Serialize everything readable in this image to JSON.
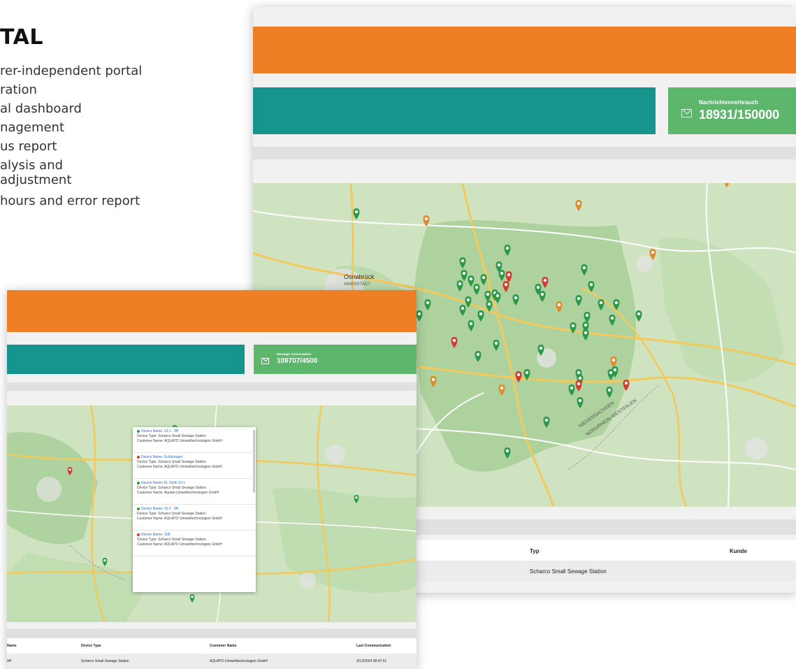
{
  "marketing": {
    "title": "TAL",
    "features": [
      "rer-independent portal",
      "ration",
      "al dashboard",
      "nagement",
      "us report",
      "alysis and",
      "adjustment",
      "hours and error report"
    ]
  },
  "back_screen": {
    "stat_label": "Nachrichtenverbrauch",
    "stat_value": "18931/150000",
    "map_labels": [
      "Osnabrück",
      "INNENSTADT",
      "NIEDERSACHSEN",
      "NORDRHEIN-WESTFALEN"
    ],
    "table_headers": [
      "Typ",
      "Kunde"
    ],
    "table_row": [
      "Scharco Small Sewage Station"
    ]
  },
  "front_screen": {
    "stat_label": "Message Consumption",
    "stat_value": "109707/4500",
    "popup_entries": [
      {
        "status": "green",
        "name_line": "Device Name: 13.1 · 9H",
        "type_line": "Device Type: Scharco Small Sewage Station",
        "customer_line": "Customer Name: AQUATO Umwelttechnologien GmbH"
      },
      {
        "status": "red",
        "name_line": "Device Name: Schulungen",
        "type_line": "Device Type: Scharco Small Sewage Station",
        "customer_line": "Customer Name: AQUATO Umwelttechnologien GmbH"
      },
      {
        "status": "green",
        "name_line": "Device Name: KL Stufe 10.1",
        "type_line": "Device Type: Scharco Small Sewage Station",
        "customer_line": "Customer Name: Aquato Umwelttechnologien GmbH"
      },
      {
        "status": "green",
        "name_line": "Device Name: 10.2 · 9H",
        "type_line": "Device Type: Scharco Small Sewage Station",
        "customer_line": "Customer Name: AQUATO Umwelttechnologien GmbH"
      },
      {
        "status": "red",
        "name_line": "Device Name: 11B",
        "type_line": "Device Type: Scharco Small Sewage Station",
        "customer_line": "Customer Name: AQUATO Umwelttechnologien GmbH"
      }
    ],
    "table_headers": [
      "Name",
      "Device Type",
      "Customer Name",
      "Last Communication"
    ],
    "table_row": [
      "9H",
      "Scharco Small Sewage Station",
      "AQUATO Umwelttechnologien GmbH",
      "3/13/2024 08:47:01"
    ]
  },
  "colors": {
    "orange": "#ee7f25",
    "teal": "#16958f",
    "stat_green": "#5cb66b",
    "marker_green": "#2b9a48",
    "marker_red": "#d33a30",
    "marker_orange": "#e08a2c"
  }
}
